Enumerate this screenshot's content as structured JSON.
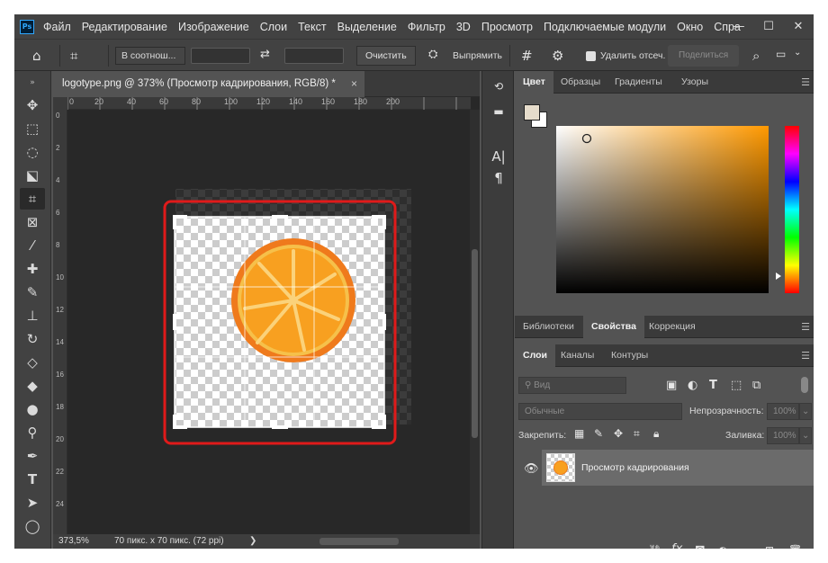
{
  "app": {
    "logo": "Ps"
  },
  "menu": [
    "Файл",
    "Редактирование",
    "Изображение",
    "Слои",
    "Текст",
    "Выделение",
    "Фильтр",
    "3D",
    "Просмотр",
    "Подключаемые модули",
    "Окно",
    "Спра"
  ],
  "window_controls": {
    "minimize": "—",
    "maximize": "☐",
    "close": "✕"
  },
  "options": {
    "ratio_select": "В соотнош...",
    "swap_icon": "⇄",
    "clear_label": "Очистить",
    "straighten_label": "Выпрямить",
    "delete_cropped_label": "Удалить отсеч. п",
    "share_label": "Поделиться"
  },
  "document": {
    "tab_title": "logotype.png @ 373% (Просмотр кадрирования, RGB/8) *",
    "close": "×",
    "ruler_h_ticks": [
      "0",
      "20",
      "40",
      "60",
      "80",
      "100",
      "120",
      "140",
      "160",
      "180",
      "200"
    ],
    "ruler_v_ticks": [
      "0",
      "2",
      "4",
      "6",
      "8",
      "10",
      "12",
      "14",
      "16",
      "18",
      "20",
      "22",
      "24"
    ],
    "zoom": "373,5%",
    "dimensions": "70 пикс. x 70 пикс. (72 ppi)",
    "status_arrow": "❯"
  },
  "panels": {
    "color_tabs": [
      "Цвет",
      "Образцы",
      "Градиенты",
      "Узоры"
    ],
    "props_tabs": [
      "Библиотеки",
      "Свойства",
      "Коррекция"
    ],
    "layer_tabs": [
      "Слои",
      "Каналы",
      "Контуры"
    ],
    "filter_kind": "Вид",
    "blend_mode": "Обычные",
    "opacity_label": "Непрозрачность:",
    "opacity_value": "100%",
    "lock_label": "Закрепить:",
    "fill_label": "Заливка:",
    "fill_value": "100%",
    "layer_name": "Просмотр кадрирования"
  },
  "colors": {
    "accent": "#e01a1a",
    "orange": "#f7a11f",
    "orange_dark": "#ee7a1c"
  }
}
